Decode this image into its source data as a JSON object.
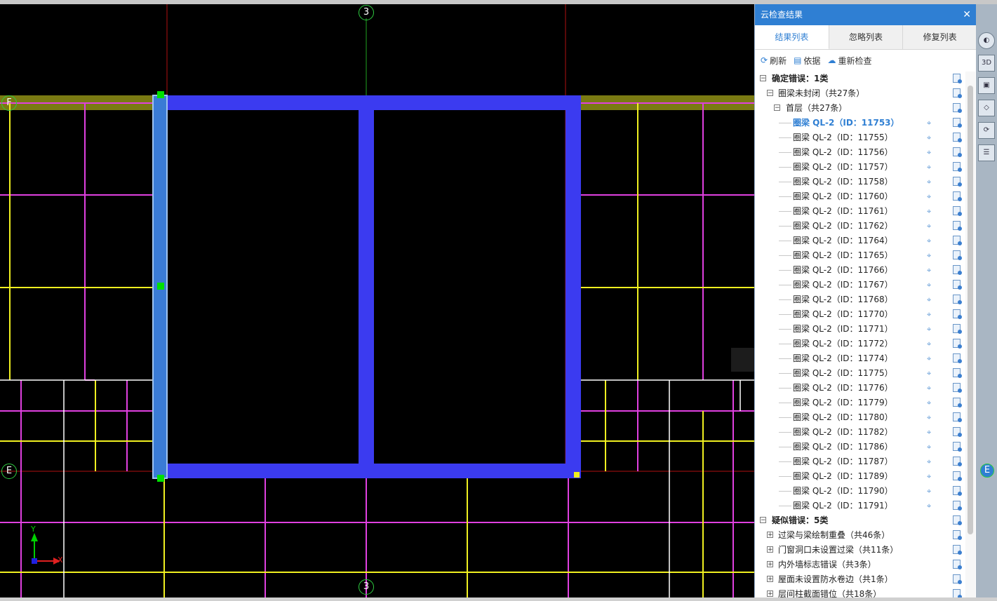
{
  "canvas": {
    "axis_labels": {
      "top": "3",
      "bottom": "3",
      "left_f": "F",
      "left_e": "E",
      "right_e": "E"
    },
    "ucs": {
      "y": "Y",
      "x": "X"
    }
  },
  "panel": {
    "title": "云检查结果",
    "close": "✕",
    "tabs": [
      "结果列表",
      "忽略列表",
      "修复列表"
    ],
    "actions": {
      "refresh": "刷新",
      "basis": "依据",
      "recheck": "重新检查"
    },
    "tree": {
      "confirmed": {
        "toggle": "⊟",
        "label": "确定错误：1类"
      },
      "group": {
        "toggle": "⊟",
        "label": "圈梁未封闭（共27条）"
      },
      "floor": {
        "toggle": "⊟",
        "label": "首层（共27条）"
      },
      "items": [
        "圈梁 QL-2（ID：11753）",
        "圈梁 QL-2（ID：11755）",
        "圈梁 QL-2（ID：11756）",
        "圈梁 QL-2（ID：11757）",
        "圈梁 QL-2（ID：11758）",
        "圈梁 QL-2（ID：11760）",
        "圈梁 QL-2（ID：11761）",
        "圈梁 QL-2（ID：11762）",
        "圈梁 QL-2（ID：11764）",
        "圈梁 QL-2（ID：11765）",
        "圈梁 QL-2（ID：11766）",
        "圈梁 QL-2（ID：11767）",
        "圈梁 QL-2（ID：11768）",
        "圈梁 QL-2（ID：11770）",
        "圈梁 QL-2（ID：11771）",
        "圈梁 QL-2（ID：11772）",
        "圈梁 QL-2（ID：11774）",
        "圈梁 QL-2（ID：11775）",
        "圈梁 QL-2（ID：11776）",
        "圈梁 QL-2（ID：11779）",
        "圈梁 QL-2（ID：11780）",
        "圈梁 QL-2（ID：11782）",
        "圈梁 QL-2（ID：11786）",
        "圈梁 QL-2（ID：11787）",
        "圈梁 QL-2（ID：11789）",
        "圈梁 QL-2（ID：11790）",
        "圈梁 QL-2（ID：11791）"
      ],
      "suspected": {
        "toggle": "⊟",
        "label": "疑似错误：5类"
      },
      "suspected_items": [
        "过梁与梁绘制重叠（共46条）",
        "门窗洞口未设置过梁（共11条）",
        "内外墙标志错误（共3条）",
        "屋面未设置防水卷边（共1条）",
        "层间柱截面错位（共18条）"
      ],
      "expand_symbol": "⊞"
    }
  },
  "toolbar": {
    "b3d": "3D",
    "rotate": "⟳"
  },
  "colors": {
    "accent": "#2f7fd3",
    "beam_blue": "#3b3bf0",
    "magenta": "#e040e0",
    "yellow": "#f0f020",
    "olive": "#7a7a12"
  }
}
